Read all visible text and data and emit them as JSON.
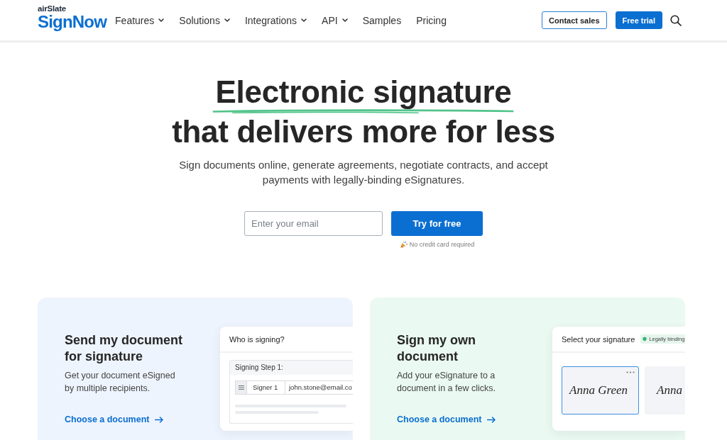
{
  "header": {
    "logo": {
      "brand": "airSlate",
      "product": "SignNow"
    },
    "nav": [
      {
        "label": "Features",
        "has_menu": true
      },
      {
        "label": "Solutions",
        "has_menu": true
      },
      {
        "label": "Integrations",
        "has_menu": true
      },
      {
        "label": "API",
        "has_menu": true
      },
      {
        "label": "Samples",
        "has_menu": false
      },
      {
        "label": "Pricing",
        "has_menu": false
      }
    ],
    "buttons": [
      {
        "label": "Contact sales",
        "kind": "outline"
      },
      {
        "label": "Free trial",
        "kind": "primary"
      }
    ]
  },
  "hero": {
    "title_underlined": "Electronic signature",
    "title_rest": "that delivers more for less",
    "subtitle": "Sign documents online, generate agreements, negotiate contracts, and accept payments with legally-binding eSignatures.",
    "email_field": {
      "placeholder": "Enter your email"
    },
    "cta": "Try for free",
    "note": "No credit card required"
  },
  "cards": [
    {
      "kind": "send",
      "title": "Send my document for signature",
      "description": "Get your document eSigned by multiple recipients.",
      "link": "Choose a document",
      "mockup": {
        "kind": "signers",
        "title": "Who is signing?",
        "step": "Signing Step 1:",
        "signers": [
          {
            "name": "Signer 1",
            "email": "john.stone@email.co"
          }
        ]
      }
    },
    {
      "kind": "sign",
      "title": "Sign my own document",
      "description": "Add your eSignature to a document in a few clicks.",
      "link": "Choose a document",
      "mockup": {
        "kind": "signatures",
        "title": "Select your signature",
        "badge": "Legally binding",
        "signatures": [
          {
            "text": "Anna Green",
            "selected": true
          },
          {
            "text": "Anna",
            "selected": false
          }
        ]
      }
    }
  ]
}
